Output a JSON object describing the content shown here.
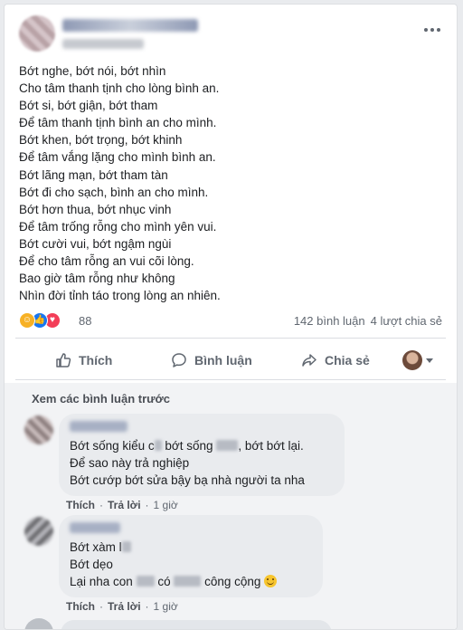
{
  "post": {
    "menu_icon": "more-horizontal-icon",
    "poem_lines": [
      "Bớt nghe, bớt nói, bớt nhìn",
      "Cho tâm thanh tịnh cho lòng bình an.",
      "Bớt si, bớt giận, bớt tham",
      "Để  tâm thanh tịnh bình an cho mình.",
      "Bớt khen, bớt trọng, bớt khinh",
      "Để tâm vắng lặng cho mình bình an.",
      "Bớt lãng mạn, bớt tham tàn",
      "Bớt đi cho sạch, bình an cho mình.",
      "Bớt hơn thua, bớt nhục vinh",
      "Để tâm trống rỗng cho mình yên vui.",
      "Bớt cười vui, bớt ngậm ngùi",
      "Để cho tâm rỗng an vui cõi lòng.",
      "Bao giờ tâm rỗng như không",
      "Nhìn đời tỉnh táo trong lòng an nhiên."
    ]
  },
  "stats": {
    "reaction_icons": [
      "haha-icon",
      "like-icon",
      "love-icon"
    ],
    "reaction_count": "88",
    "comments": "142 bình luận",
    "shares": "4 lượt chia sẻ"
  },
  "actions": {
    "like": "Thích",
    "comment": "Bình luận",
    "share": "Chia sẻ"
  },
  "comments_section": {
    "see_previous": "Xem các bình luận trước",
    "comments": [
      {
        "line1_a": "Bớt sống kiểu c",
        "line1_b": "bớt sống",
        "line1_c": ", bớt bớt lại.",
        "line2": "Để sao này trả nghiệp",
        "line3": "Bớt cướp bớt sửa bậy bạ nhà người ta nha",
        "like": "Thích",
        "reply": "Trả lời",
        "time": "1 giờ"
      },
      {
        "line1": "Bớt xàm l",
        "line2": "Bớt dẹo",
        "line3_a": "Lại nha con",
        "line3_b": "có",
        "line3_c": "công cộng",
        "like": "Thích",
        "reply": "Trả lời",
        "time": "1 giờ"
      }
    ],
    "separator": "·"
  }
}
